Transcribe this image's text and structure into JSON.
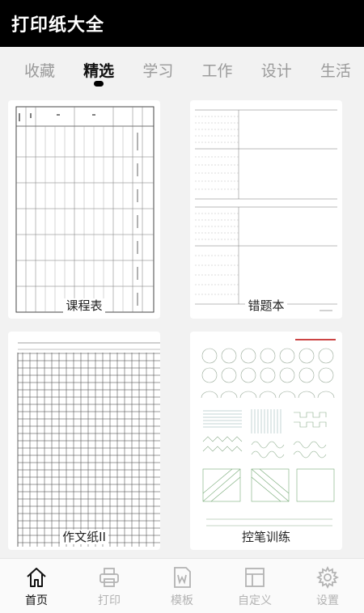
{
  "app": {
    "title": "打印纸大全"
  },
  "tabs": [
    {
      "label": "收藏",
      "active": false
    },
    {
      "label": "精选",
      "active": true
    },
    {
      "label": "学习",
      "active": false
    },
    {
      "label": "工作",
      "active": false
    },
    {
      "label": "设计",
      "active": false
    },
    {
      "label": "生活",
      "active": false
    }
  ],
  "cards": [
    {
      "label": "课程表"
    },
    {
      "label": "错题本"
    },
    {
      "label": "作文纸II"
    },
    {
      "label": "控笔训练"
    }
  ],
  "bottom_nav": [
    {
      "label": "首页",
      "icon": "home-icon",
      "active": true
    },
    {
      "label": "打印",
      "icon": "printer-icon",
      "active": false
    },
    {
      "label": "模板",
      "icon": "word-template-icon",
      "active": false
    },
    {
      "label": "自定义",
      "icon": "layout-icon",
      "active": false
    },
    {
      "label": "设置",
      "icon": "gear-icon",
      "active": false
    }
  ],
  "colors": {
    "header_bg": "#000000",
    "active_tab": "#111111",
    "inactive": "#9a9a9a",
    "nav_inactive": "#b3b3b3"
  }
}
